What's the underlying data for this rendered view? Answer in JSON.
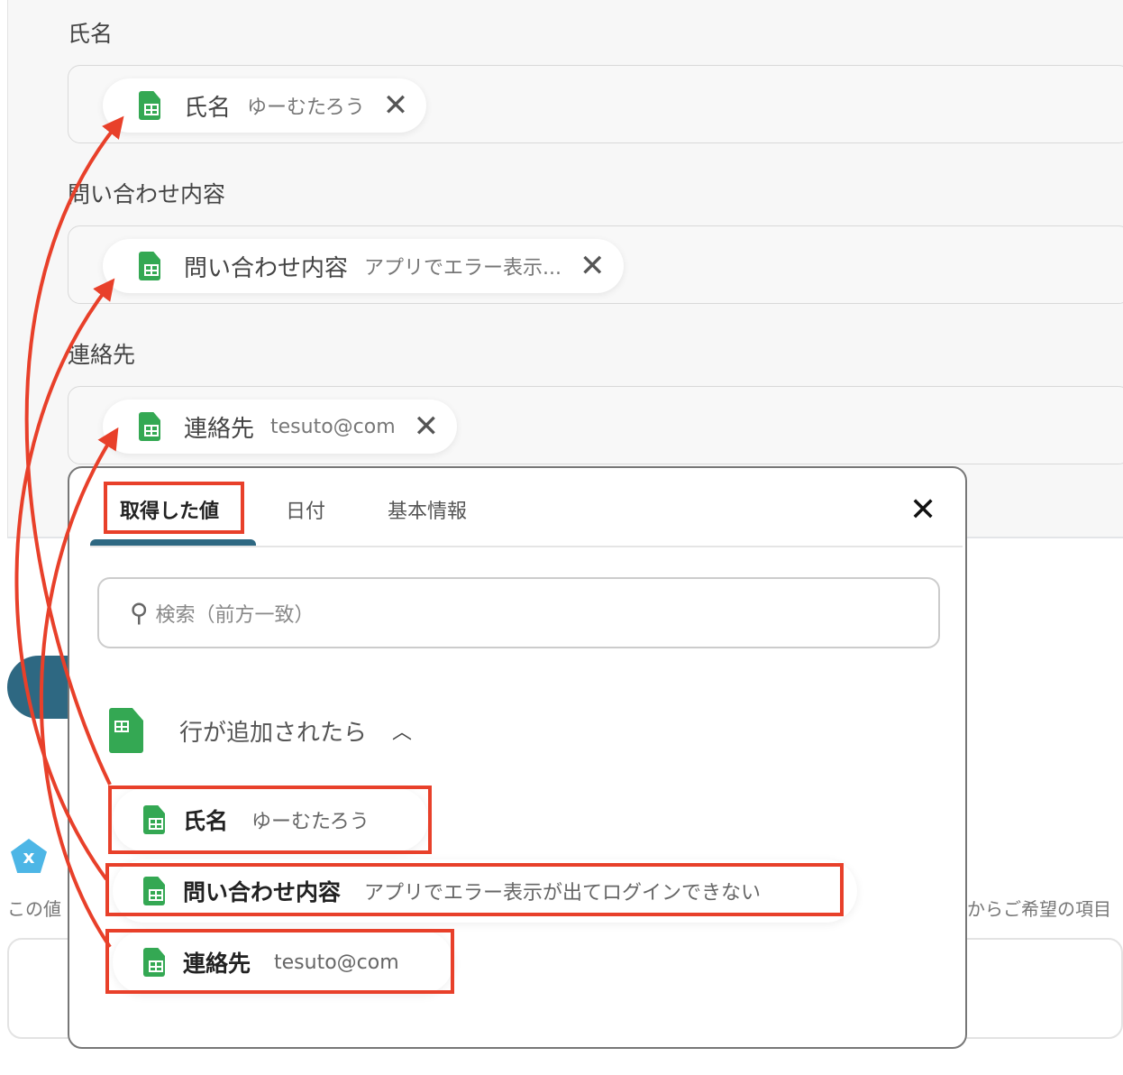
{
  "fields": [
    {
      "label": "氏名",
      "chip_name": "氏名",
      "chip_value": "ゆーむたろう"
    },
    {
      "label": "問い合わせ内容",
      "chip_name": "問い合わせ内容",
      "chip_value": "アプリでエラー表示..."
    },
    {
      "label": "連絡先",
      "chip_name": "連絡先",
      "chip_value": "tesuto@com"
    }
  ],
  "background": {
    "hint_text_left": "この値",
    "hint_text_right": "からご希望の項目"
  },
  "popup": {
    "tabs": [
      {
        "label": "取得した値",
        "active": true
      },
      {
        "label": "日付"
      },
      {
        "label": "基本情報"
      }
    ],
    "close_icon": "close-icon",
    "search_placeholder": "検索（前方一致）",
    "section_title": "行が追加されたら",
    "items": [
      {
        "name": "氏名",
        "value": "ゆーむたろう"
      },
      {
        "name": "問い合わせ内容",
        "value": "アプリでエラー表示が出てログインできない"
      },
      {
        "name": "連絡先",
        "value": "tesuto@com"
      }
    ]
  },
  "colors": {
    "accent": "#2e6882",
    "highlight": "#e8402a",
    "sheets": "#34a853"
  }
}
